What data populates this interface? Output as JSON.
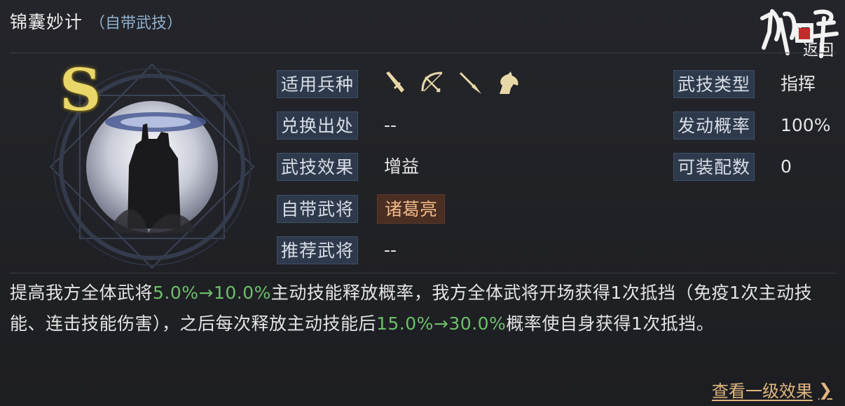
{
  "skill": {
    "name": "锦囊妙计",
    "origin": "（自带武技）",
    "grade": "S"
  },
  "logo": {
    "return_label": "返回"
  },
  "fields": {
    "troop_label": "适用兵种",
    "troop_icons": [
      "sword-icon",
      "bow-icon",
      "spear-icon",
      "horse-icon"
    ],
    "exchange_label": "兑换出处",
    "exchange_value": "--",
    "effect_label": "武技效果",
    "effect_value": "增益",
    "general_label": "自带武将",
    "general_value": "诸葛亮",
    "recommend_label": "推荐武将",
    "recommend_value": "--",
    "type_label": "武技类型",
    "type_value": "指挥",
    "chance_label": "发动概率",
    "chance_value": "100%",
    "equip_label": "可装配数",
    "equip_value": "0"
  },
  "description": {
    "p1": "提高我方全体武将",
    "hl1": "5.0%→10.0%",
    "p2": "主动技能释放概率，我方全体武将开场获得1次抵挡（免疫1次主动技能、连击技能伤害），之后每次释放主动技能后",
    "hl2": "15.0%→30.0%",
    "p3": "概率使自身获得1次抵挡。"
  },
  "footer": {
    "view_label": "查看一级效果",
    "chevron": "❯"
  },
  "colors": {
    "highlight": "#6dbf6a",
    "label_bg": "#2e3a4c",
    "general_bg": "#4a2e22",
    "link": "#e0b680",
    "grade": "#e9d76a"
  }
}
